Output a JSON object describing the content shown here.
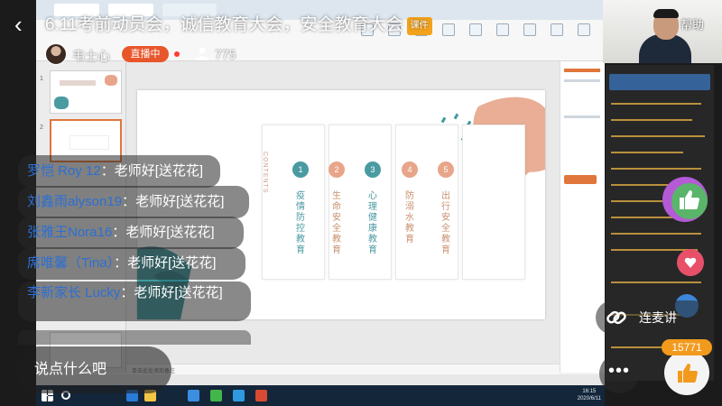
{
  "live": {
    "title": "6.11考前动员会，诚信教育大会，安全教育大会",
    "title_badge": "课件",
    "host_name": "韦士心",
    "status": "直播中",
    "viewer_count": "775",
    "help": "帮助"
  },
  "chat": {
    "messages": [
      {
        "user": "罗恺 Roy 12",
        "sep": "：",
        "text": "老师好[送花花]"
      },
      {
        "user": "刘鑫雨alyson19",
        "sep": "：",
        "text": "老师好[送花花]"
      },
      {
        "user": "张雅王Nora16",
        "sep": "：",
        "text": "老师好[送花花]"
      },
      {
        "user": "席唯馨（Tina）",
        "sep": "：",
        "text": "老师好[送花花]"
      },
      {
        "user": "李新家长 Lucky",
        "sep": "：",
        "text": "老师好[送花花]"
      }
    ],
    "input_placeholder": "说点什么吧"
  },
  "controls": {
    "connect_mic": "连麦讲",
    "like_count": "15771",
    "more": "•••"
  },
  "slide": {
    "contents_label": "CONTENTS",
    "items": [
      {
        "num": "1",
        "label": "疫情防控教育",
        "color": "#4a9aa2"
      },
      {
        "num": "2",
        "label": "生命安全教育",
        "color": "#e8a58a"
      },
      {
        "num": "3",
        "label": "心理健康教育",
        "color": "#4a9aa2"
      },
      {
        "num": "4",
        "label": "防溺水教育",
        "color": "#e8a58a"
      },
      {
        "num": "5",
        "label": "出行安全教育",
        "color": "#e8a58a"
      }
    ]
  },
  "ppt": {
    "thumb_numbers": [
      "1",
      "2"
    ],
    "notes_placeholder": "单击此处添加备注",
    "clock_time": "16:15",
    "clock_date": "2020/6/11"
  },
  "colors": {
    "accent_orange": "#e8562b",
    "teal": "#4a9aa2",
    "salmon": "#e8a58a",
    "like_orange": "#f29a1d"
  }
}
